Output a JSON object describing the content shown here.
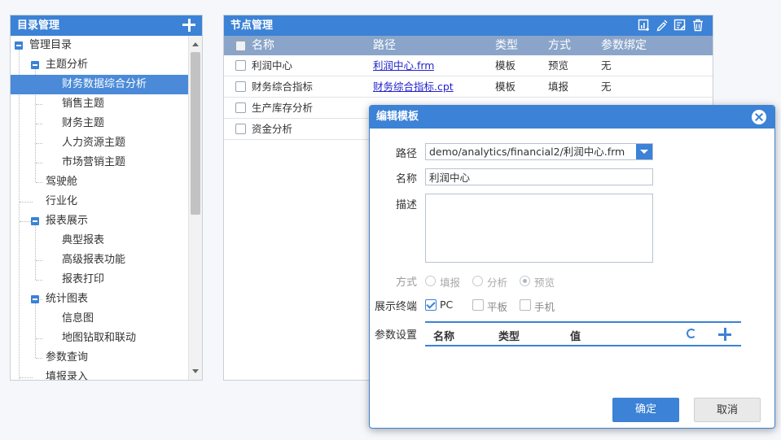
{
  "tree_panel": {
    "title": "目录管理",
    "items": [
      {
        "label": "管理目录"
      },
      {
        "label": "主题分析"
      },
      {
        "label": "财务数据综合分析"
      },
      {
        "label": "销售主题"
      },
      {
        "label": "财务主题"
      },
      {
        "label": "人力资源主题"
      },
      {
        "label": "市场营销主题"
      },
      {
        "label": "驾驶舱"
      },
      {
        "label": "行业化"
      },
      {
        "label": "报表展示"
      },
      {
        "label": "典型报表"
      },
      {
        "label": "高级报表功能"
      },
      {
        "label": "报表打印"
      },
      {
        "label": "统计图表"
      },
      {
        "label": "信息图"
      },
      {
        "label": "地图钻取和联动"
      },
      {
        "label": "参数查询"
      },
      {
        "label": "填报录入"
      }
    ],
    "selected_item": "财务数据综合分析"
  },
  "node_panel": {
    "title": "节点管理",
    "toolbar_icons": [
      "report-add-icon",
      "edit-icon",
      "template-edit-icon",
      "trash-icon"
    ],
    "columns": [
      "名称",
      "路径",
      "类型",
      "方式",
      "参数绑定"
    ],
    "rows": [
      {
        "name": "利润中心",
        "path": "利润中心.frm",
        "type": "模板",
        "mode": "预览",
        "binding": "无"
      },
      {
        "name": "财务综合指标",
        "path": "财务综合指标.cpt",
        "type": "模板",
        "mode": "填报",
        "binding": "无"
      },
      {
        "name": "生产库存分析",
        "path": "",
        "type": "",
        "mode": "",
        "binding": ""
      },
      {
        "name": "资金分析",
        "path": "",
        "type": "",
        "mode": "",
        "binding": ""
      }
    ]
  },
  "dialog": {
    "title": "编辑模板",
    "path_label": "路径",
    "path_value": "demo/analytics/financial2/利润中心.frm",
    "name_label": "名称",
    "name_value": "利润中心",
    "desc_label": "描述",
    "desc_value": "",
    "mode_label": "方式",
    "mode_options": [
      "填报",
      "分析",
      "预览"
    ],
    "mode_selected": "预览",
    "terminal_label": "展示终端",
    "terminal_options": [
      {
        "label": "PC",
        "checked": true
      },
      {
        "label": "平板",
        "checked": false
      },
      {
        "label": "手机",
        "checked": false
      }
    ],
    "param_label": "参数设置",
    "param_columns": [
      "名称",
      "类型",
      "值"
    ],
    "ok_label": "确定",
    "cancel_label": "取消"
  },
  "colors": {
    "accent": "#3c82d6",
    "header_gray_blue": "#8aa5c9",
    "selected": "#4a8ad8"
  }
}
